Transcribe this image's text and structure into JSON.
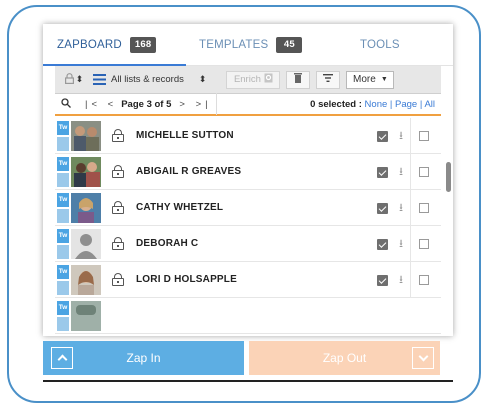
{
  "tabs": [
    {
      "label": "ZAPBOARD",
      "badge": "168",
      "active": true
    },
    {
      "label": "TEMPLATES",
      "badge": "45",
      "active": false
    },
    {
      "label": "TOOLS",
      "badge": "",
      "active": false
    }
  ],
  "toolbar": {
    "list_label": "All lists & records",
    "enrich_label": "Enrich",
    "more_label": "More"
  },
  "pager": {
    "page_text": "Page 3 of 5",
    "selected_count": "0 selected",
    "selected_sep": ":",
    "link_none": "None",
    "link_page": "Page",
    "link_all": "All",
    "divider": "|"
  },
  "rows": [
    {
      "name": "MICHELLE SUTTON",
      "tw_label": "Tw"
    },
    {
      "name": "ABIGAIL R GREAVES",
      "tw_label": "Tw"
    },
    {
      "name": "CATHY WHETZEL",
      "tw_label": "Tw"
    },
    {
      "name": "DEBORAH C",
      "tw_label": "Tw"
    },
    {
      "name": "LORI D HOLSAPPLE",
      "tw_label": "Tw"
    },
    {
      "name": "",
      "tw_label": "Tw"
    }
  ],
  "bottom": {
    "zap_in_label": "Zap In",
    "zap_out_label": "Zap Out"
  },
  "colors": {
    "accent_blue": "#5daee3",
    "zap_out_peach": "#fbd3b7",
    "pager_orange": "#f0a040",
    "frame_blue": "#4a90c8"
  }
}
